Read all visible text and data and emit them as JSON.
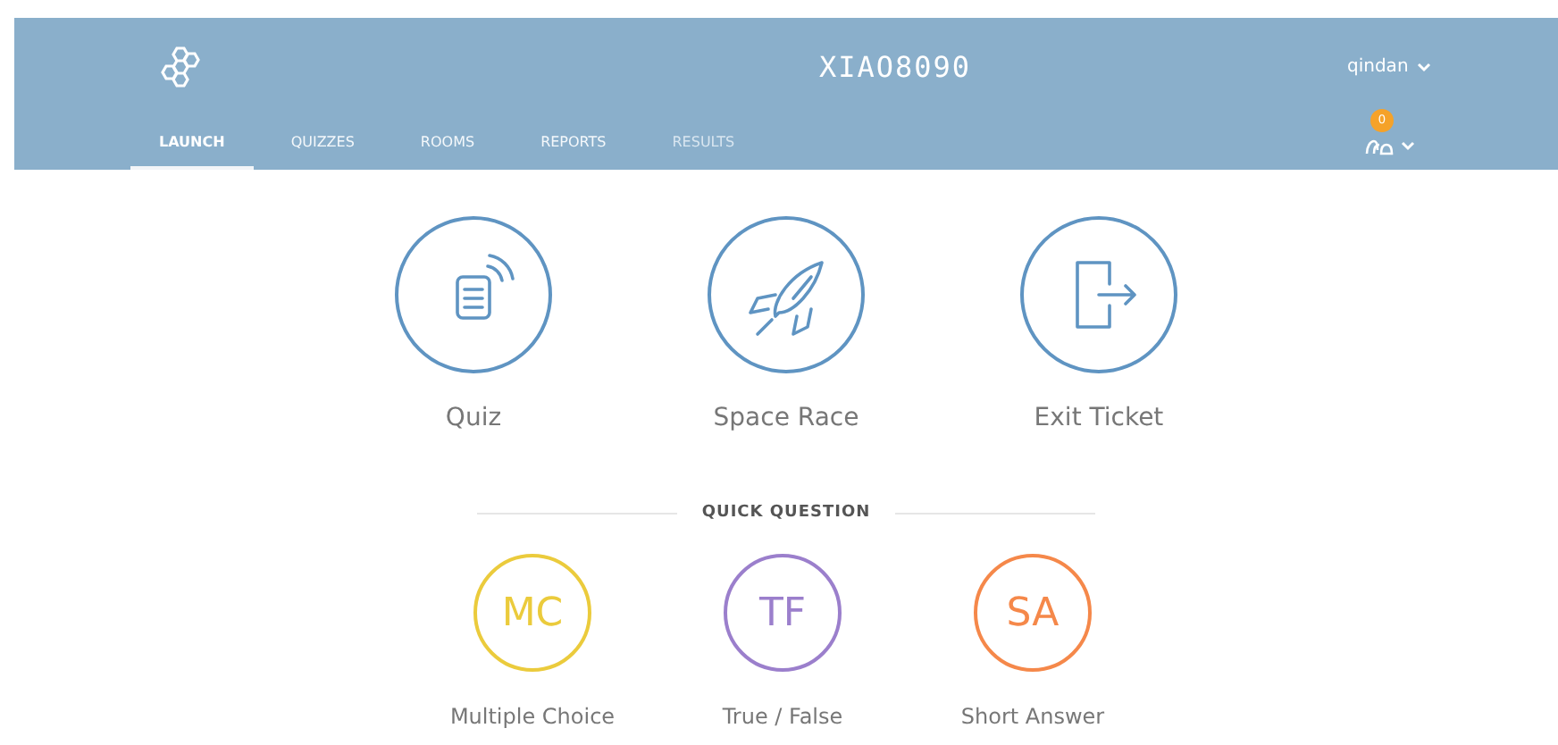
{
  "header": {
    "title": "XIAO8090",
    "user": "qindan",
    "notifications": "0"
  },
  "tabs": [
    {
      "label": "LAUNCH",
      "selected": true,
      "disabled": false
    },
    {
      "label": "QUIZZES",
      "selected": false,
      "disabled": false
    },
    {
      "label": "ROOMS",
      "selected": false,
      "disabled": false
    },
    {
      "label": "REPORTS",
      "selected": false,
      "disabled": false
    },
    {
      "label": "RESULTS",
      "selected": false,
      "disabled": true
    }
  ],
  "launch_items": [
    {
      "kind": "quiz",
      "label": "Quiz"
    },
    {
      "kind": "rocket",
      "label": "Space Race"
    },
    {
      "kind": "exit",
      "label": "Exit Ticket"
    }
  ],
  "quick_question": {
    "heading": "QUICK QUESTION",
    "items": [
      {
        "abbr": "MC",
        "label": "Multiple Choice",
        "color": "#ebcb3c"
      },
      {
        "abbr": "TF",
        "label": "True / False",
        "color": "#9b7fcc"
      },
      {
        "abbr": "SA",
        "label": "Short Answer",
        "color": "#f5884a"
      }
    ]
  }
}
